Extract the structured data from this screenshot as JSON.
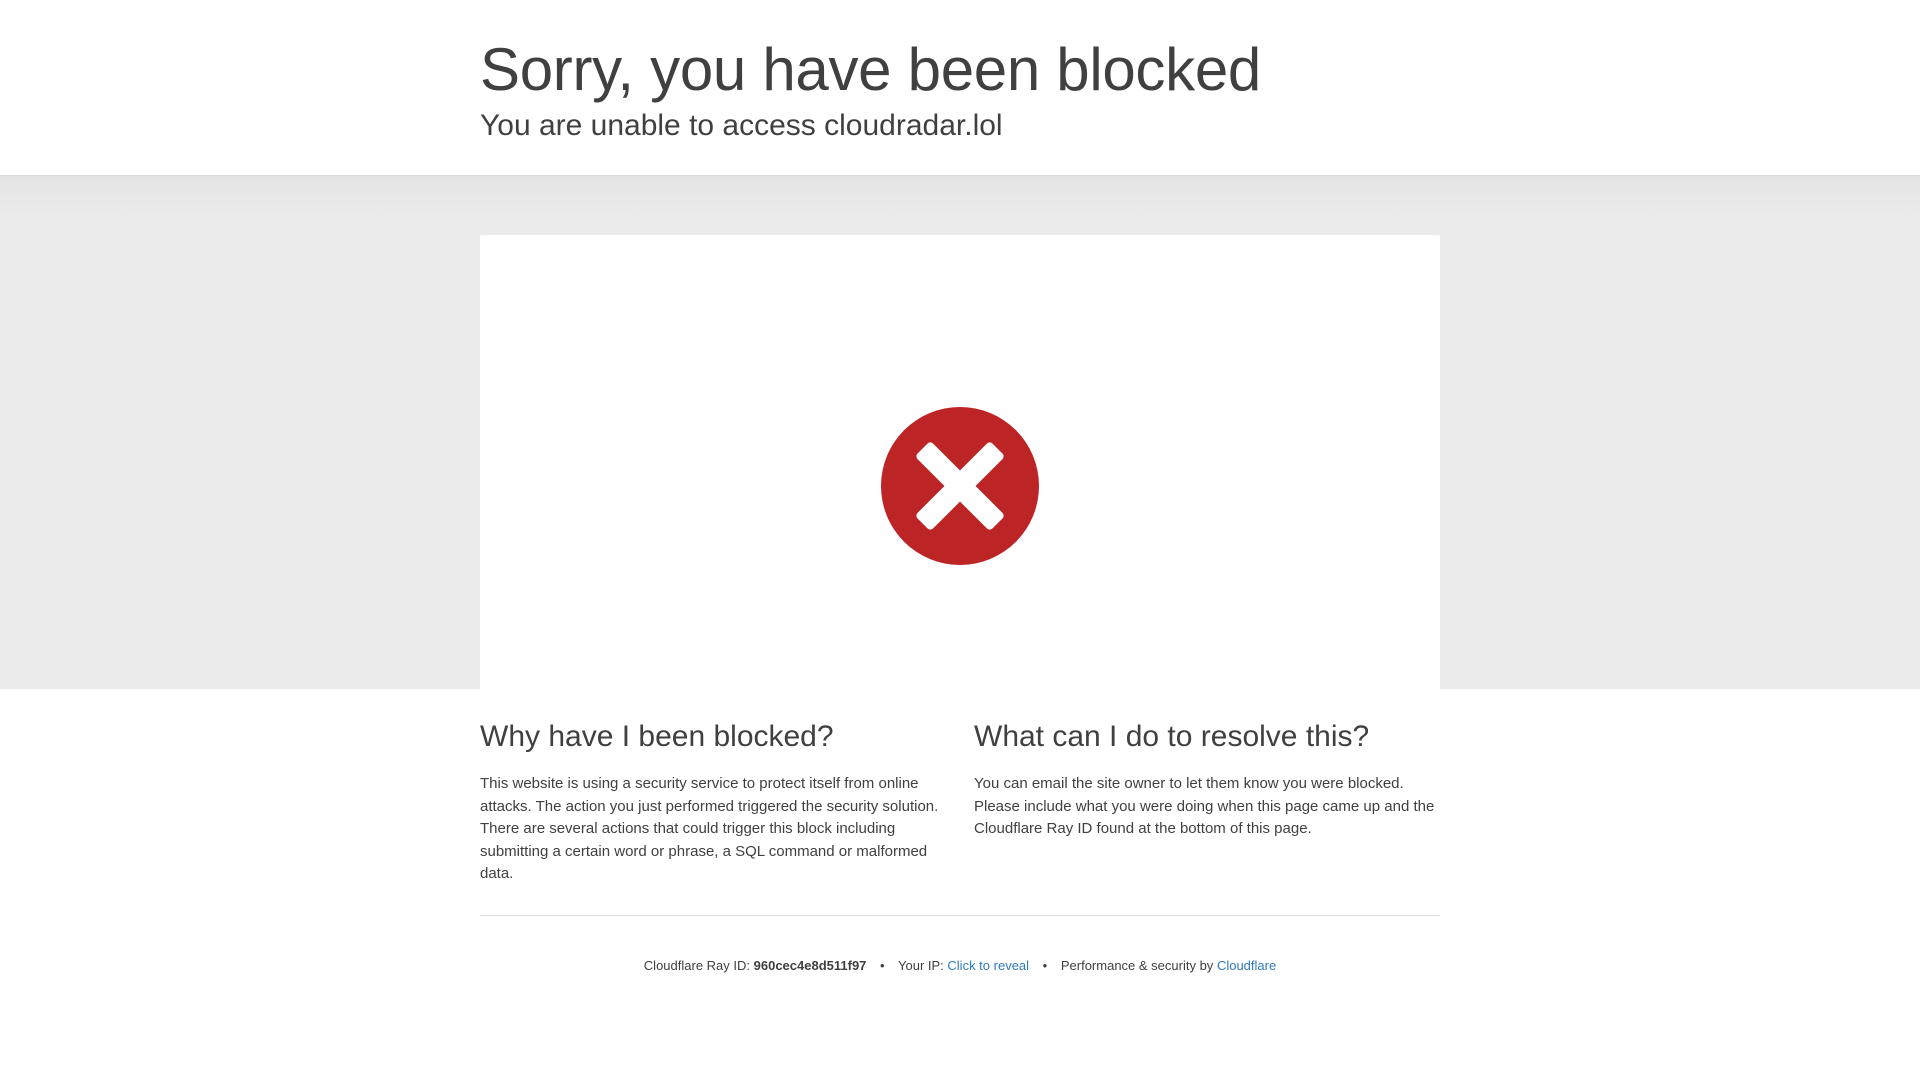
{
  "header": {
    "title": "Sorry, you have been blocked",
    "subtitle": "You are unable to access cloudradar.lol"
  },
  "icons": {
    "block_icon": "error-x-circle-icon",
    "block_icon_color": "#bd2426"
  },
  "why": {
    "heading": "Why have I been blocked?",
    "body": "This website is using a security service to protect itself from online attacks. The action you just performed triggered the security solution. There are several actions that could trigger this block including submitting a certain word or phrase, a SQL command or malformed data."
  },
  "resolve": {
    "heading": "What can I do to resolve this?",
    "body": "You can email the site owner to let them know you were blocked. Please include what you were doing when this page came up and the Cloudflare Ray ID found at the bottom of this page."
  },
  "footer": {
    "ray_label": "Cloudflare Ray ID:",
    "ray_id": "960cec4e8d511f97",
    "separator": "•",
    "ip_label": "Your IP:",
    "ip_link": "Click to reveal",
    "perf_label": "Performance & security by",
    "brand_link": "Cloudflare",
    "link_color": "#2f7bbf"
  }
}
